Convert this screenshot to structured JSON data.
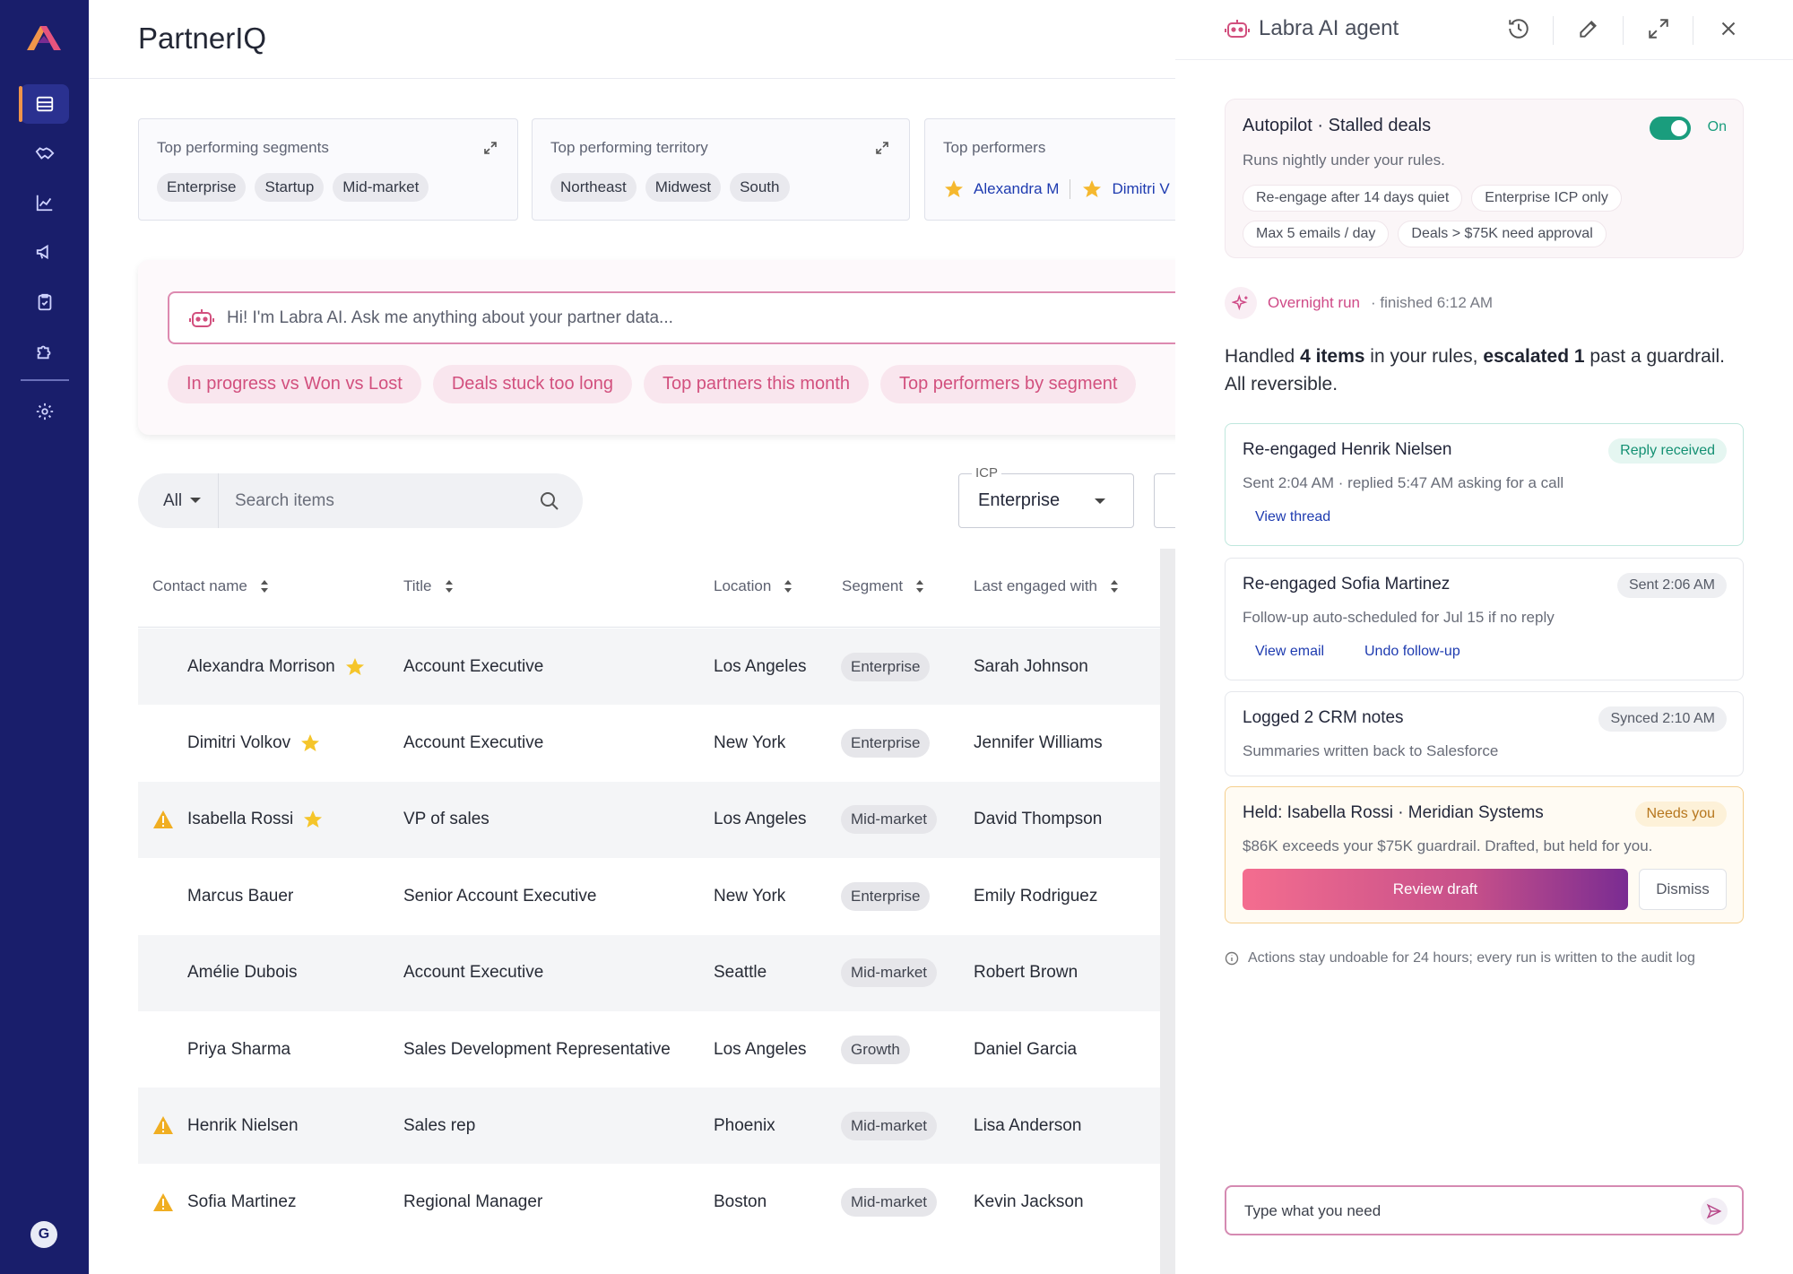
{
  "app": {
    "title": "PartnerIQ",
    "avatar_initial": "G"
  },
  "nav": [
    {
      "icon": "inbox-icon",
      "active": true
    },
    {
      "icon": "handshake-icon"
    },
    {
      "icon": "line-chart-icon"
    },
    {
      "icon": "megaphone-icon"
    },
    {
      "icon": "clipboard-check-icon"
    },
    {
      "icon": "puzzle-icon"
    },
    {
      "icon": "gear-icon"
    }
  ],
  "cards": {
    "segments": {
      "title": "Top performing segments",
      "chips": [
        "Enterprise",
        "Startup",
        "Mid-market"
      ]
    },
    "territory": {
      "title": "Top performing territory",
      "chips": [
        "Northeast",
        "Midwest",
        "South"
      ]
    },
    "performers": {
      "title": "Top performers",
      "names": [
        "Alexandra M",
        "Dimitri V"
      ]
    }
  },
  "ask": {
    "placeholder": "Hi! I'm Labra AI. Ask me anything about your partner data...",
    "suggestions": [
      "In progress vs Won vs Lost",
      "Deals stuck too long",
      "Top partners this month",
      "Top performers by segment"
    ]
  },
  "filter": {
    "scope": "All",
    "search_placeholder": "Search items",
    "icp_label": "ICP",
    "icp_value": "Enterprise"
  },
  "table": {
    "columns": [
      "Contact name",
      "Title",
      "Location",
      "Segment",
      "Last engaged with"
    ],
    "rows": [
      {
        "name": "Alexandra Morrison",
        "star": true,
        "warn": false,
        "title": "Account Executive",
        "location": "Los Angeles",
        "segment": "Enterprise",
        "last": "Sarah Johnson"
      },
      {
        "name": "Dimitri Volkov",
        "star": true,
        "warn": false,
        "title": "Account Executive",
        "location": "New York",
        "segment": "Enterprise",
        "last": "Jennifer Williams"
      },
      {
        "name": "Isabella Rossi",
        "star": true,
        "warn": true,
        "title": "VP of sales",
        "location": "Los Angeles",
        "segment": "Mid-market",
        "last": "David Thompson"
      },
      {
        "name": "Marcus Bauer",
        "star": false,
        "warn": false,
        "title": "Senior Account Executive",
        "location": "New York",
        "segment": "Enterprise",
        "last": "Emily Rodriguez"
      },
      {
        "name": "Amélie Dubois",
        "star": false,
        "warn": false,
        "title": "Account Executive",
        "location": "Seattle",
        "segment": "Mid-market",
        "last": "Robert Brown"
      },
      {
        "name": "Priya Sharma",
        "star": false,
        "warn": false,
        "title": "Sales Development Representative",
        "location": "Los Angeles",
        "segment": "Growth",
        "last": "Daniel Garcia"
      },
      {
        "name": "Henrik Nielsen",
        "star": false,
        "warn": true,
        "title": "Sales rep",
        "location": "Phoenix",
        "segment": "Mid-market",
        "last": "Lisa Anderson"
      },
      {
        "name": "Sofia Martinez",
        "star": false,
        "warn": true,
        "title": "Regional Manager",
        "location": "Boston",
        "segment": "Mid-market",
        "last": "Kevin Jackson"
      }
    ]
  },
  "agent": {
    "title": "Labra AI agent",
    "autopilot": {
      "title": "Autopilot · Stalled deals",
      "subtitle": "Runs nightly under your rules.",
      "toggle_label": "On",
      "rules": [
        "Re-engage after 14 days quiet",
        "Enterprise ICP only",
        "Max 5 emails / day",
        "Deals > $75K need approval"
      ]
    },
    "run": {
      "label": "Overnight run",
      "finished": "· finished 6:12 AM"
    },
    "summary": {
      "pre": "Handled ",
      "b1": "4 items",
      "mid": " in your rules, ",
      "b2": "escalated 1",
      "post": " past a guardrail. All reversible."
    },
    "events": [
      {
        "title": "Re-engaged Henrik Nielsen",
        "badge": "Reply received",
        "desc": "Sent 2:04 AM · replied 5:47 AM asking for a call",
        "links": [
          "View thread"
        ]
      },
      {
        "title": "Re-engaged Sofia Martinez",
        "badge": "Sent 2:06 AM",
        "desc": "Follow-up auto-scheduled for Jul 15 if no reply",
        "links": [
          "View email",
          "Undo follow-up"
        ]
      },
      {
        "title": "Logged 2 CRM notes",
        "badge": "Synced 2:10 AM",
        "desc": "Summaries written back to Salesforce",
        "links": []
      },
      {
        "title": "Held: Isabella Rossi · Meridian Systems",
        "badge": "Needs you",
        "desc": "$86K exceeds your $75K guardrail. Drafted, but held for you.",
        "primary": "Review draft",
        "secondary": "Dismiss"
      }
    ],
    "note": "Actions stay undoable for 24 hours; every run is written to the audit log",
    "input_placeholder": "Type what you need"
  }
}
